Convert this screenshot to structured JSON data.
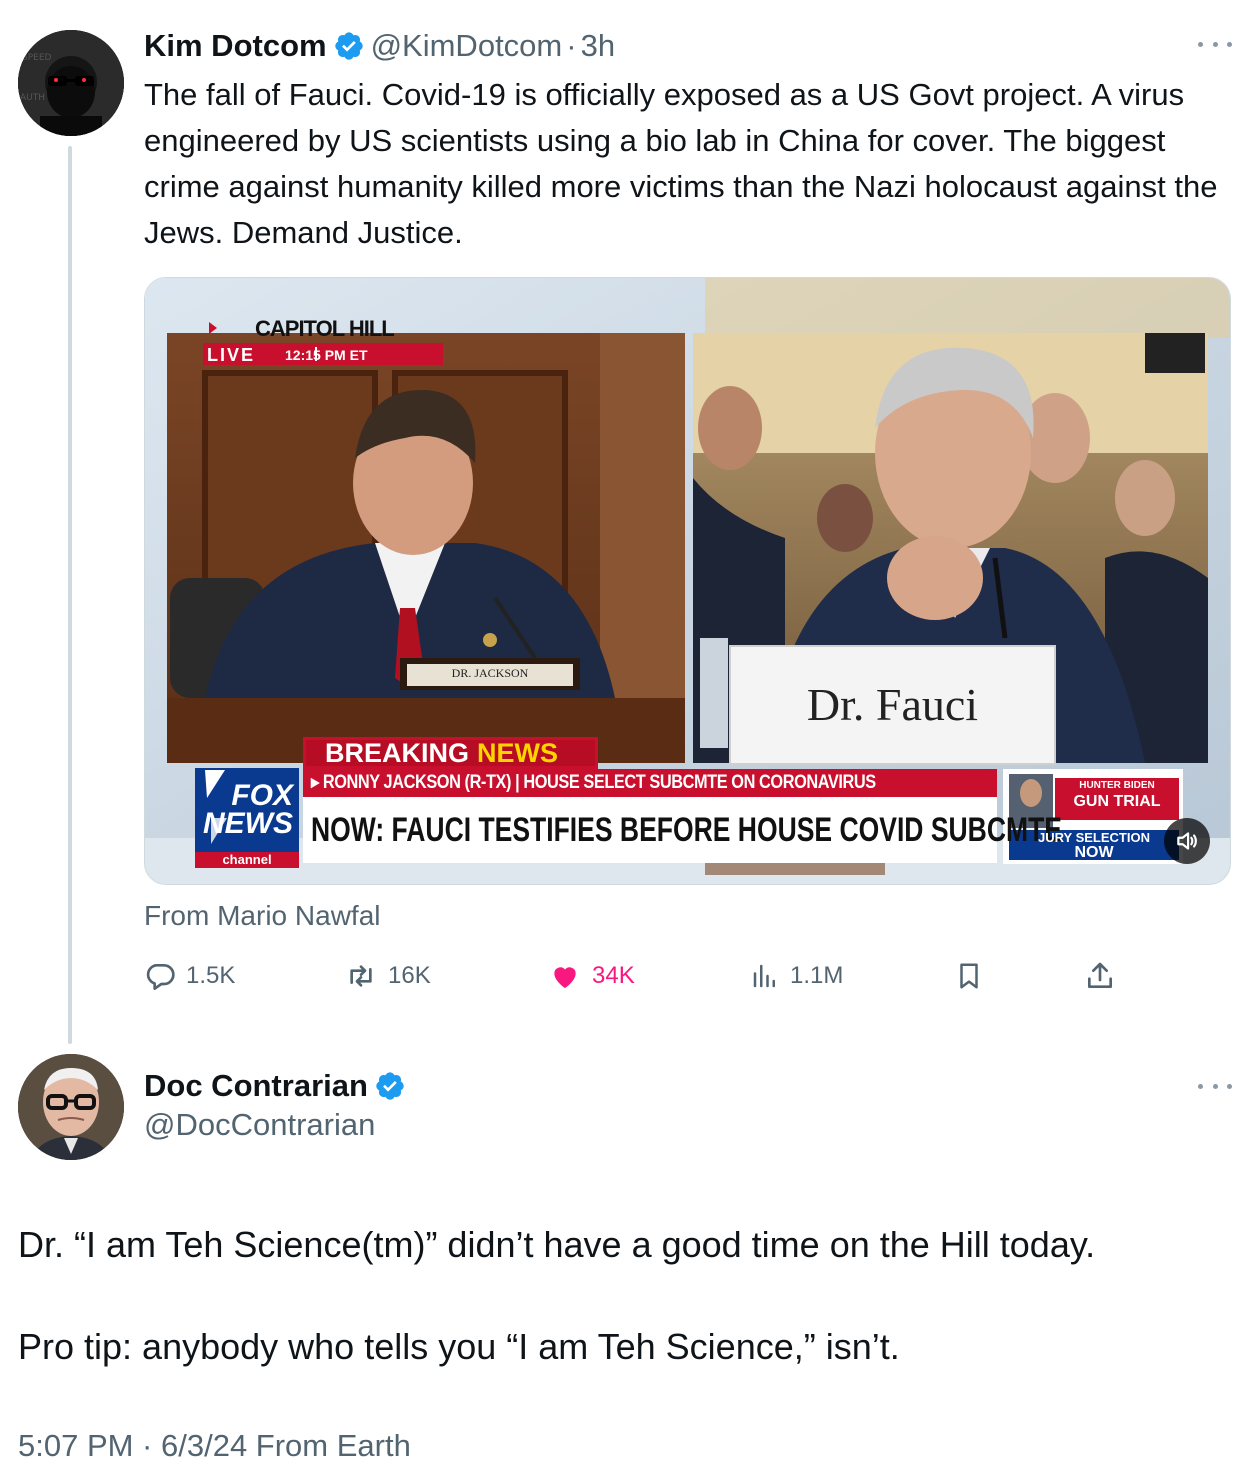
{
  "tweet1": {
    "author_name": "Kim Dotcom",
    "handle": "@KimDotcom",
    "separator": "·",
    "time": "3h",
    "text": "The fall of Fauci. Covid-19 is officially exposed as a US Govt project. A virus engineered by US scientists using a bio lab in China for cover. The biggest crime against humanity killed more victims than the Nazi holocaust against the Jews. Demand Justice.",
    "media": {
      "location_bug": "CAPITOL HILL",
      "live_label": "LIVE",
      "live_time": "12:15 PM ET",
      "left_placard": "DR. JACKSON",
      "right_placard": "Dr. Fauci",
      "breaking_label": "BREAKING",
      "breaking_news": "NEWS",
      "subtitle": "▸ RONNY JACKSON (R-TX) | HOUSE SELECT SUBCMTE ON CORONAVIRUS",
      "headline": "NOW: FAUCI TESTIFIES BEFORE HOUSE COVID SUBCMTE",
      "network_logo_line1": "FOX",
      "network_logo_line2": "NEWS",
      "network_logo_line3": "channel",
      "promo_line1": "HUNTER BIDEN",
      "promo_line2": "GUN TRIAL",
      "promo_line3": "JURY SELECTION",
      "promo_line4": "NOW"
    },
    "source": "From Mario Nawfal",
    "stats": {
      "replies": "1.5K",
      "reposts": "16K",
      "likes": "34K",
      "views": "1.1M"
    },
    "icons": [
      "verified-badge-icon",
      "more-icon",
      "reply-icon",
      "repost-icon",
      "heart-icon",
      "views-icon",
      "bookmark-icon",
      "share-icon",
      "volume-icon"
    ]
  },
  "tweet2": {
    "author_name": "Doc Contrarian",
    "handle": "@DocContrarian",
    "text_line1": "Dr. “I am Teh Science(tm)” didn’t have a good time on the Hill today.",
    "text_line2": "Pro tip: anybody who tells you “I am Teh Science,” isn’t.",
    "timestamp": "5:07 PM · 6/3/24 From Earth"
  },
  "colors": {
    "accent_blue": "#1d9bf0",
    "like_pink": "#f91880",
    "secondary_text": "#536471",
    "fox_red": "#c8102e",
    "fox_blue": "#003a8c"
  }
}
